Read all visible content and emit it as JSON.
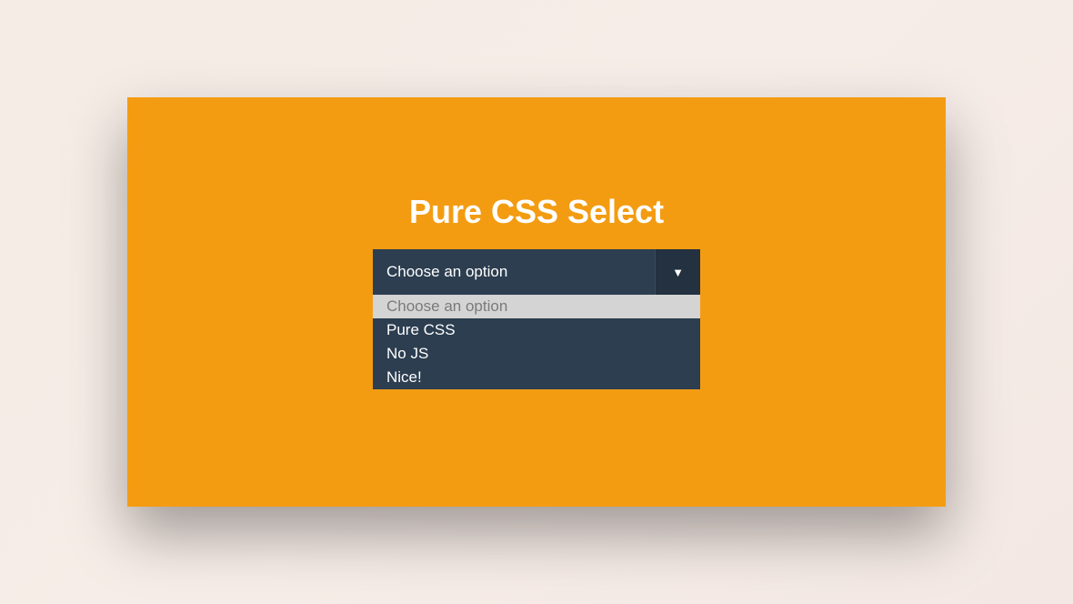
{
  "title": "Pure CSS Select",
  "select": {
    "placeholder": "Choose an option",
    "options": [
      "Choose an option",
      "Pure CSS",
      "No JS",
      "Nice!"
    ],
    "selected_index": 0
  },
  "colors": {
    "card_bg": "#f39c12",
    "select_bg": "#2c3e50",
    "arrow_bg": "#233140",
    "selected_bg": "#d4d4d4"
  }
}
